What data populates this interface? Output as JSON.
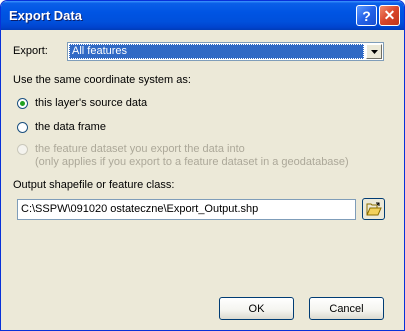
{
  "window": {
    "title": "Export Data",
    "help_glyph": "?",
    "close_glyph": "✕"
  },
  "export": {
    "label": "Export:",
    "selected": "All features"
  },
  "coordinate": {
    "label": "Use the same coordinate system as:",
    "options": [
      {
        "label": "this layer's source data",
        "checked": true,
        "enabled": true
      },
      {
        "label": "the data frame",
        "checked": false,
        "enabled": true
      },
      {
        "label_line1": "the feature dataset you export the data into",
        "label_line2": "(only applies if you export to a feature dataset in a geodatabase)",
        "checked": false,
        "enabled": false
      }
    ]
  },
  "output": {
    "label": "Output shapefile or feature class:",
    "value": "C:\\SSPW\\091020 ostateczne\\Export_Output.shp"
  },
  "buttons": {
    "ok": "OK",
    "cancel": "Cancel"
  },
  "colors": {
    "titlebar": "#0054e3",
    "selection": "#316ac5",
    "dialog_bg": "#ece9d8"
  },
  "icons": {
    "browse": "open-folder-icon",
    "dropdown": "chevron-down-icon"
  }
}
